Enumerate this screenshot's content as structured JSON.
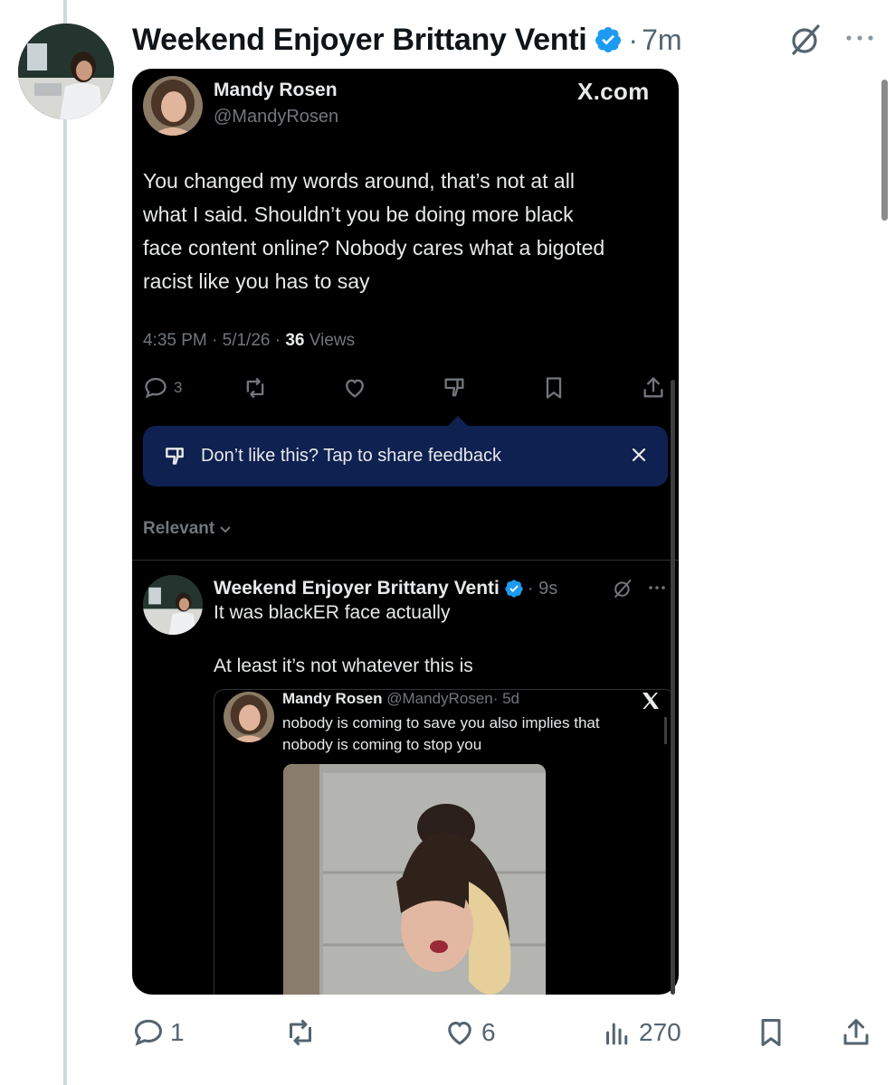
{
  "post": {
    "author_name": "Weekend Enjoyer Brittany Venti",
    "separator": "·",
    "time": "7m"
  },
  "quoted_screenshot": {
    "author_name": "Mandy Rosen",
    "author_handle": "@MandyRosen",
    "brand": "X.com",
    "text_lines": [
      "You changed my words around, that’s not at all",
      "what I said. Shouldn’t you be doing more black",
      "face content online? Nobody cares what a bigoted",
      "racist like you has to say"
    ],
    "meta_prefix": "4:35 PM · 5/1/26 · ",
    "views_count": "36",
    "views_label": " Views",
    "reply_count": "3",
    "feedback_tooltip": "Don’t like this? Tap to share feedback",
    "sort_label": "Relevant",
    "reply": {
      "author_name": "Weekend Enjoyer Brittany Venti",
      "time": "· 9s",
      "line1": "It was blackER face actually",
      "line2": "At least it’s not whatever this is",
      "embedded": {
        "author_name": "Mandy Rosen",
        "author_handle": "@MandyRosen",
        "time": "· 5d",
        "line1": "nobody is coming to save you also implies that",
        "line2": "nobody is coming to stop you"
      }
    }
  },
  "actions": {
    "replies": "1",
    "likes": "6",
    "views": "270"
  },
  "colors": {
    "verified_blue": "#1d9bf0",
    "tooltip_bg": "#0e2150",
    "muted": "#536471"
  }
}
